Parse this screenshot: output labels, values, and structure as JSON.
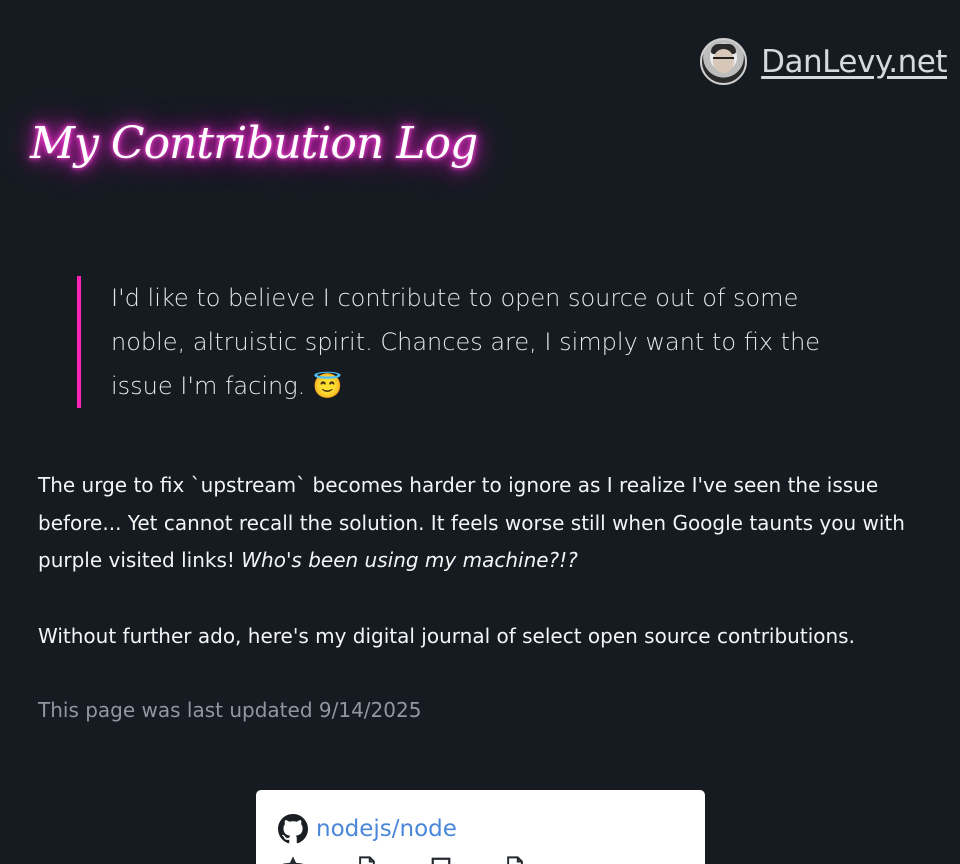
{
  "header": {
    "site_name": "DanLevy.net",
    "avatar_alt": "Dan Levy avatar"
  },
  "page": {
    "title": "My Contribution Log"
  },
  "quote": {
    "text": "I'd like to believe I contribute to open source out of some noble, altruistic spirit. Chances are, I simply want to fix the issue I'm facing. 😇"
  },
  "body": {
    "paragraph1_text": "The urge to fix `upstream` becomes harder to ignore as I realize I've seen the issue before... Yet cannot recall the solution. It feels worse still when Google taunts you with purple visited links! ",
    "paragraph1_emphasis": "Who's been using my machine?!?",
    "paragraph2_text": "Without further ado, here's my digital journal of select open source contributions.",
    "last_updated": "This page was last updated 9/14/2025"
  },
  "repo_card": {
    "repo_name": "nodejs/node",
    "icon": "github-icon",
    "stat_icons": [
      "star-icon",
      "file-icon",
      "issue-icon",
      "file-icon"
    ]
  },
  "colors": {
    "background": "#151b21",
    "neon_glow": "#ff2bd6",
    "quote_border": "#ff22b8",
    "link_blue": "#4a86d9",
    "muted_text": "#8f979f"
  }
}
